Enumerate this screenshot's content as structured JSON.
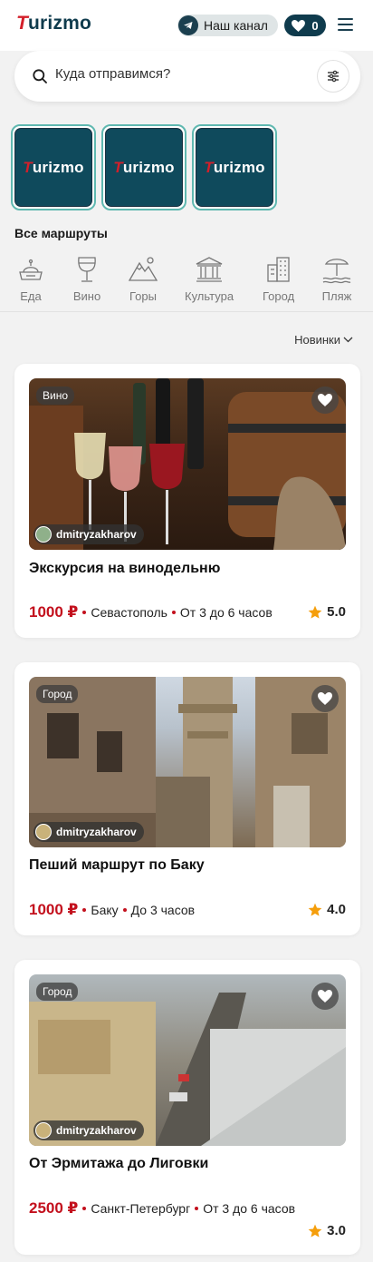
{
  "header": {
    "logo_text": "Turizmo",
    "channel_label": "Наш канал",
    "favorites_count": "0"
  },
  "search": {
    "placeholder": "Куда отправимся?"
  },
  "stories": [
    {
      "label": "Turizmo"
    },
    {
      "label": "Turizmo"
    },
    {
      "label": "Turizmo"
    }
  ],
  "routes_title": "Все маршруты",
  "categories": [
    {
      "label": "Еда",
      "icon": "food-icon"
    },
    {
      "label": "Вино",
      "icon": "wine-icon"
    },
    {
      "label": "Горы",
      "icon": "mountains-icon"
    },
    {
      "label": "Культура",
      "icon": "museum-icon"
    },
    {
      "label": "Город",
      "icon": "city-icon"
    },
    {
      "label": "Пляж",
      "icon": "beach-icon"
    }
  ],
  "sort": {
    "selected": "Новинки"
  },
  "cards": [
    {
      "badge": "Вино",
      "author": "dmitryzakharov",
      "title": "Экскурсия на винодельню",
      "price": "1000 ₽",
      "city": "Севастополь",
      "duration": "От 3 до 6 часов",
      "rating": "5.0"
    },
    {
      "badge": "Город",
      "author": "dmitryzakharov",
      "title": "Пеший маршрут по Баку",
      "price": "1000 ₽",
      "city": "Баку",
      "duration": "До 3 часов",
      "rating": "4.0"
    },
    {
      "badge": "Город",
      "author": "dmitryzakharov",
      "title": "От Эрмитажа до Лиговки",
      "price": "2500 ₽",
      "city": "Санкт-Петербург",
      "duration": "От 3 до 6 часов",
      "rating": "3.0"
    }
  ],
  "colors": {
    "brand_dark": "#0f3b4d",
    "accent_red": "#c3101d",
    "star": "#f59e0b"
  }
}
